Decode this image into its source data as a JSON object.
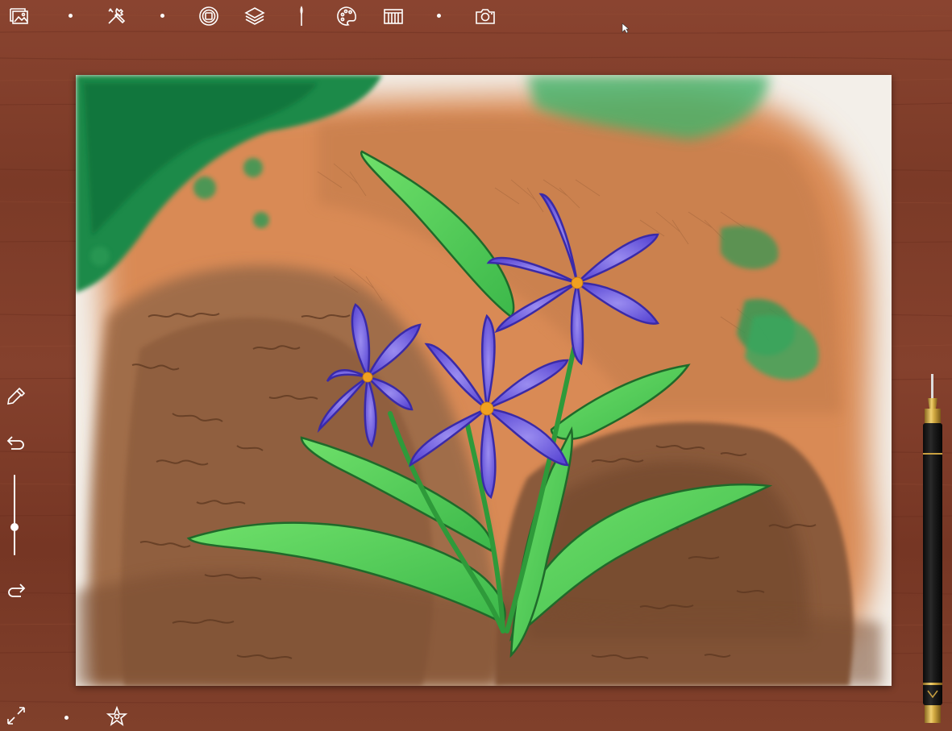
{
  "app": {
    "name": ""
  },
  "toolbar": {
    "icons": [
      "gallery-icon",
      "tools-icon",
      "brush-tool-icon",
      "layers-icon",
      "brush-icon",
      "palette-icon",
      "paper-icon",
      "camera-icon"
    ]
  },
  "side": {
    "icons": [
      "eyedropper-icon",
      "undo-icon",
      "redo-icon"
    ],
    "brush_size": 0.35
  },
  "bottom": {
    "icons": [
      "fullscreen-icon",
      "favorite-icon"
    ]
  },
  "colors": {
    "desk": "#7a3c2a",
    "paper": "#f4f1ec",
    "petal": "#6a56d8",
    "leaf": "#4cc64a",
    "soil": "#8c5a3a",
    "orange": "#d98a50",
    "moss": "#1f8a4a"
  }
}
